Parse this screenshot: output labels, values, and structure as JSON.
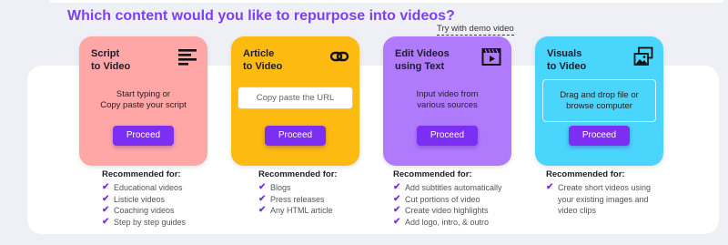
{
  "heading": "Which content would you like to repurpose into videos?",
  "demo_link": "Try with demo video",
  "colors": {
    "accent": "#7c2ef2",
    "card_script": "#ffa6a6",
    "card_article": "#fdbb11",
    "card_edit": "#b07afc",
    "card_visuals": "#49d5fc"
  },
  "cards": [
    {
      "title": "Script\nto Video",
      "icon": "text-lines-icon",
      "text": "Start typing or\nCopy paste your script",
      "button": "Proceed"
    },
    {
      "title": "Article\nto Video",
      "icon": "link-icon",
      "input_placeholder": "Copy paste the URL",
      "button": "Proceed"
    },
    {
      "title": "Edit Videos\nusing Text",
      "icon": "video-edit-icon",
      "text": "Input video from\nvarious sources",
      "button": "Proceed"
    },
    {
      "title": "Visuals\nto Video",
      "icon": "images-icon",
      "drop_text": "Drag and drop file or\nbrowse computer",
      "button": "Proceed"
    }
  ],
  "recommended": [
    {
      "title": "Recommended for:",
      "items": [
        "Educational videos",
        "Listicle videos",
        "Coaching videos",
        "Step by step guides"
      ]
    },
    {
      "title": "Recommended for:",
      "items": [
        "Blogs",
        "Press releases",
        "Any HTML article"
      ]
    },
    {
      "title": "Recommended for:",
      "items": [
        "Add subtitles automatically",
        "Cut portions of video",
        "Create video highlights",
        "Add logo, intro, & outro"
      ]
    },
    {
      "title": "Recommended for:",
      "items": [
        "Create short videos using",
        "your existing images and",
        "video clips"
      ]
    }
  ]
}
